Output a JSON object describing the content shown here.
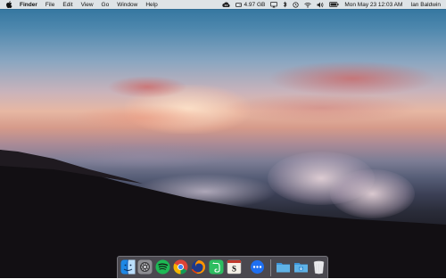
{
  "menubar": {
    "app_name": "Finder",
    "menus": [
      "File",
      "Edit",
      "View",
      "Go",
      "Window",
      "Help"
    ],
    "status": {
      "storage": "4.97 GB",
      "clock": "Mon May 23  12:03 AM",
      "user": "Ian Baldwin"
    }
  },
  "dock": {
    "apps": [
      {
        "name": "Finder",
        "icon": "finder-icon",
        "running": true
      },
      {
        "name": "System Preferences",
        "icon": "system-preferences-icon"
      },
      {
        "name": "Spotify",
        "icon": "spotify-icon"
      },
      {
        "name": "Chrome",
        "icon": "chrome-icon"
      },
      {
        "name": "Firefox",
        "icon": "firefox-icon"
      },
      {
        "name": "Evernote",
        "icon": "evernote-icon"
      },
      {
        "name": "Scrivener",
        "icon": "scrivener-icon"
      },
      {
        "name": "Messages",
        "icon": "messages-icon"
      }
    ],
    "stacks": [
      {
        "name": "Documents",
        "icon": "folder-icon"
      },
      {
        "name": "Downloads",
        "icon": "downloads-folder-icon"
      },
      {
        "name": "Trash",
        "icon": "trash-icon"
      }
    ]
  },
  "colors": {
    "menubar_bg": "#ececec",
    "spotify": "#1db954",
    "evernote": "#2dbe60",
    "folder_blue": "#5fb2e6"
  }
}
